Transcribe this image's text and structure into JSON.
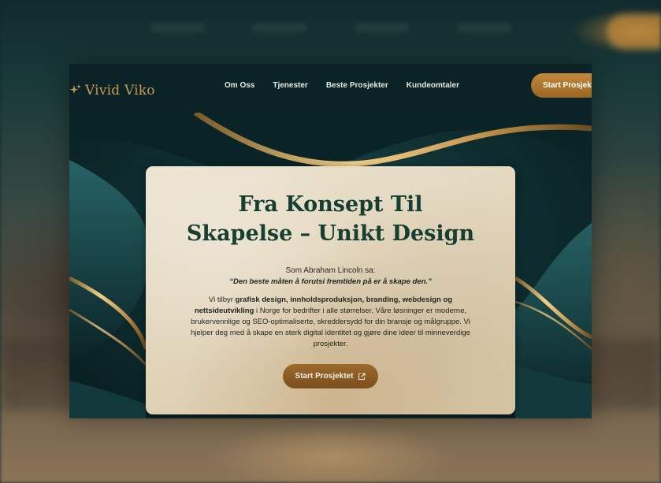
{
  "brand": {
    "name": "Vivid Viko",
    "gold": "#c79a52",
    "dark_teal": "#0b2326"
  },
  "nav": {
    "links": [
      "Om Oss",
      "Tjenester",
      "Beste Prosjekter",
      "Kundeomtaler"
    ],
    "cta_label": "Start Prosjektet"
  },
  "hero": {
    "title_line1": "Fra Konsept Til",
    "title_line2": "Skapelse – Unikt Design",
    "quote_intro": "Som Abraham Lincoln sa:",
    "quote": "“Den beste måten å forutsi fremtiden på er å skape den.”",
    "body_prefix": "Vi tilbyr ",
    "body_bold": "grafisk design, innholdsproduksjon, branding, webdesign og nettsideutvikling",
    "body_rest": " i Norge for bedrifter i alle størrelser. Våre løsninger er moderne, brukervennlige og SEO-optimaliserte, skreddersydd for din bransje og målgruppe. Vi hjelper deg med å skape en sterk digital identitet og gjøre dine ideer til minneverdige prosjekter.",
    "cta_label": "Start Prosjektet",
    "cta_icon": "external-link-icon"
  }
}
